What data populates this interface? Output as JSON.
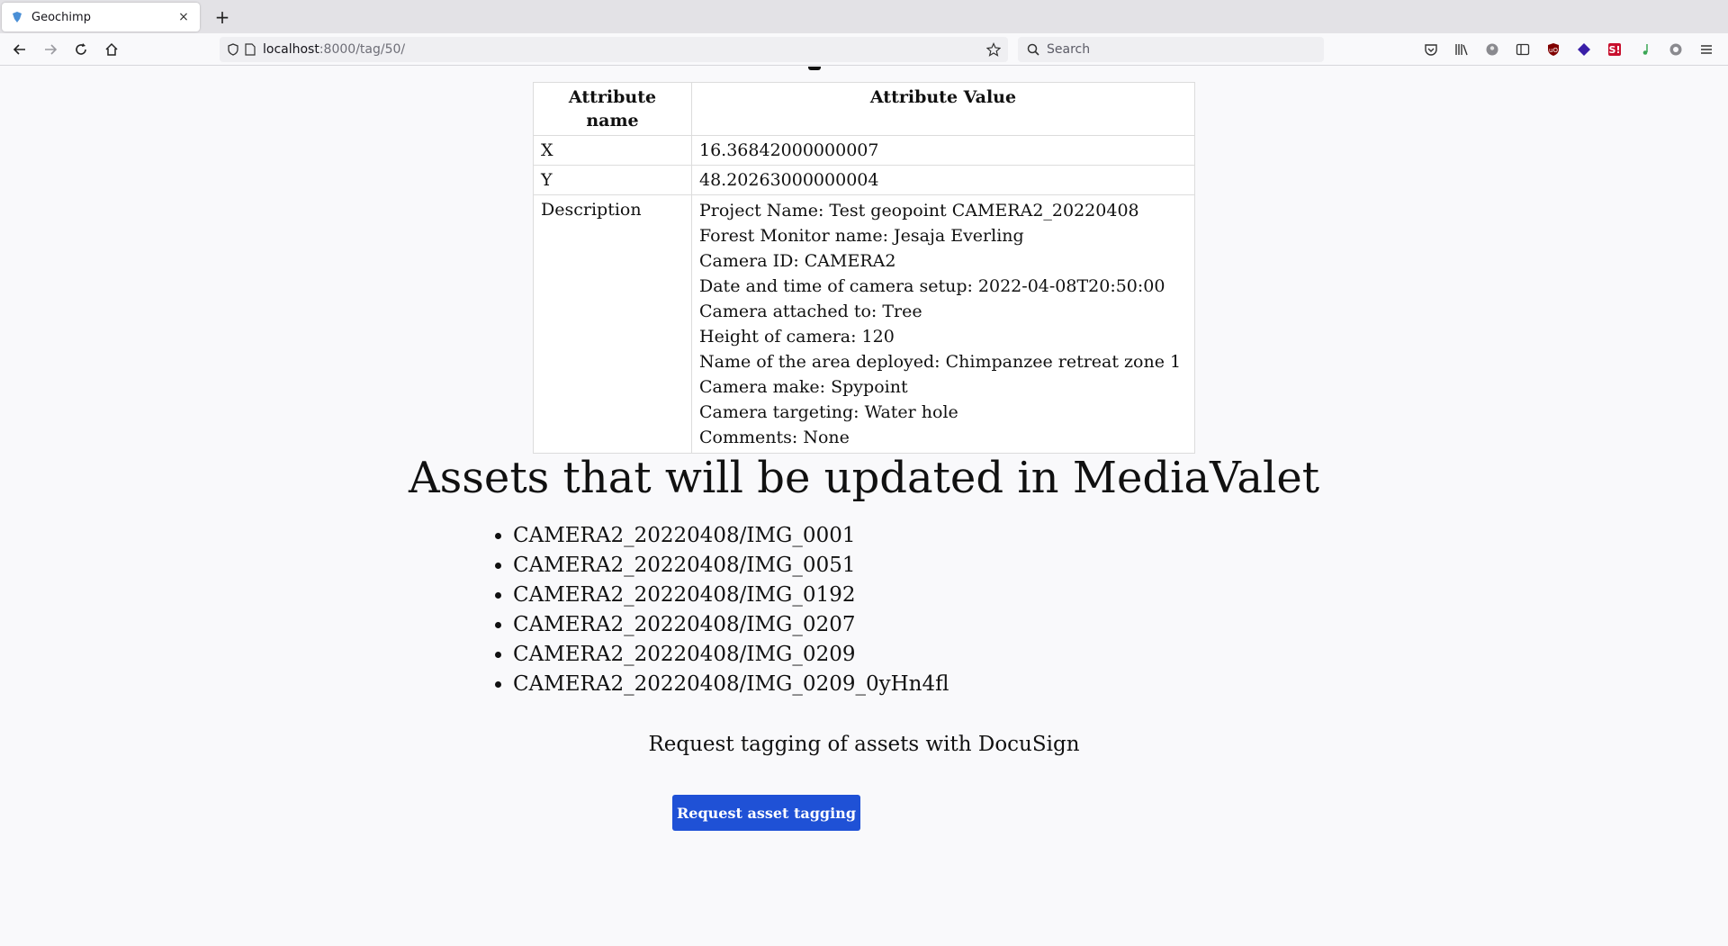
{
  "browser": {
    "tab_title": "Geochimp",
    "new_tab_label": "+",
    "close_label": "×",
    "url_host": "localhost",
    "url_path": ":8000/tag/50/",
    "search_placeholder": "Search"
  },
  "attributes_table": {
    "headers": [
      "Attribute name",
      "Attribute Value"
    ],
    "rows": [
      {
        "name": "X",
        "value": "16.36842000000007"
      },
      {
        "name": "Y",
        "value": "48.20263000000004"
      }
    ],
    "description": {
      "name": "Description",
      "lines": [
        "Project Name: Test geopoint CAMERA2_20220408",
        "Forest Monitor name: Jesaja Everling",
        "Camera ID: CAMERA2",
        "Date and time of camera setup: 2022-04-08T20:50:00",
        "Camera attached to: Tree",
        "Height of camera: 120",
        "Name of the area deployed: Chimpanzee retreat zone 1",
        "Camera make: Spypoint",
        "Camera targeting: Water hole",
        "Comments: None"
      ]
    }
  },
  "assets": {
    "title": "Assets that will be updated in MediaValet",
    "items": [
      "CAMERA2_20220408/IMG_0001",
      "CAMERA2_20220408/IMG_0051",
      "CAMERA2_20220408/IMG_0192",
      "CAMERA2_20220408/IMG_0207",
      "CAMERA2_20220408/IMG_0209",
      "CAMERA2_20220408/IMG_0209_0yHn4fl"
    ]
  },
  "tagging": {
    "text": "Request tagging of assets with DocuSign",
    "button_label": "Request asset tagging",
    "button_color": "#1f51d6"
  }
}
